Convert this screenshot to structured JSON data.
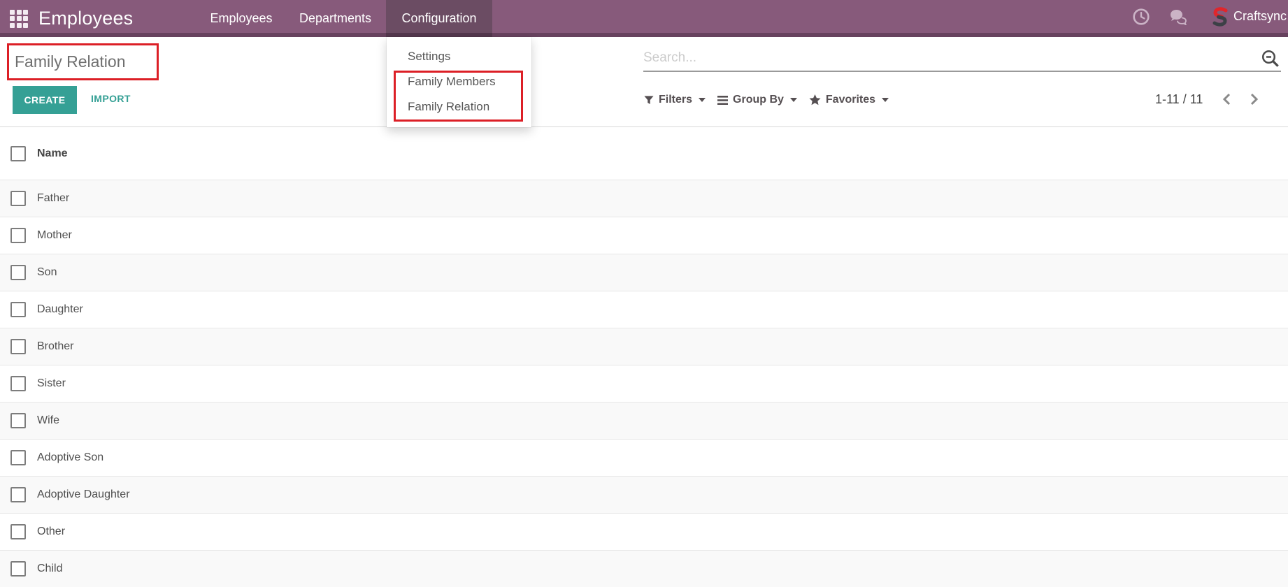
{
  "topbar": {
    "brand": "Employees",
    "menu": [
      {
        "label": "Employees",
        "active": false
      },
      {
        "label": "Departments",
        "active": false
      },
      {
        "label": "Configuration",
        "active": true
      }
    ],
    "user_name": "Craftsync"
  },
  "config_dropdown": {
    "items": [
      {
        "label": "Settings",
        "highlighted": false
      },
      {
        "label": "Family Members",
        "highlighted": true
      },
      {
        "label": "Family Relation",
        "highlighted": true
      }
    ]
  },
  "page": {
    "title": "Family Relation"
  },
  "actions": {
    "create_label": "CREATE",
    "import_label": "IMPORT"
  },
  "search": {
    "placeholder": "Search..."
  },
  "filter_bar": {
    "filters_label": "Filters",
    "group_by_label": "Group By",
    "favorites_label": "Favorites"
  },
  "pager": {
    "range_label": "1-11 / 11"
  },
  "list": {
    "column_header": "Name",
    "rows": [
      "Father",
      "Mother",
      "Son",
      "Daughter",
      "Brother",
      "Sister",
      "Wife",
      "Adoptive Son",
      "Adoptive Daughter",
      "Other",
      "Child"
    ]
  },
  "icons": {
    "apps": "apps-grid-icon",
    "activities": "clock-icon",
    "messages": "chat-bubbles-icon",
    "logo": "craftsync-logo-icon",
    "search": "zoom-out-magnifier-icon",
    "filters": "funnel-icon",
    "group_by": "list-bars-icon",
    "favorites": "star-icon",
    "pager_prev": "chevron-left-icon",
    "pager_next": "chevron-right-icon"
  },
  "colors": {
    "topbar_bg": "#875a7b",
    "topbar_active_bg": "#6b4c63",
    "primary_button": "#35a095",
    "highlight_border": "#dc1f26",
    "row_alt_bg": "#f9f9f9"
  }
}
